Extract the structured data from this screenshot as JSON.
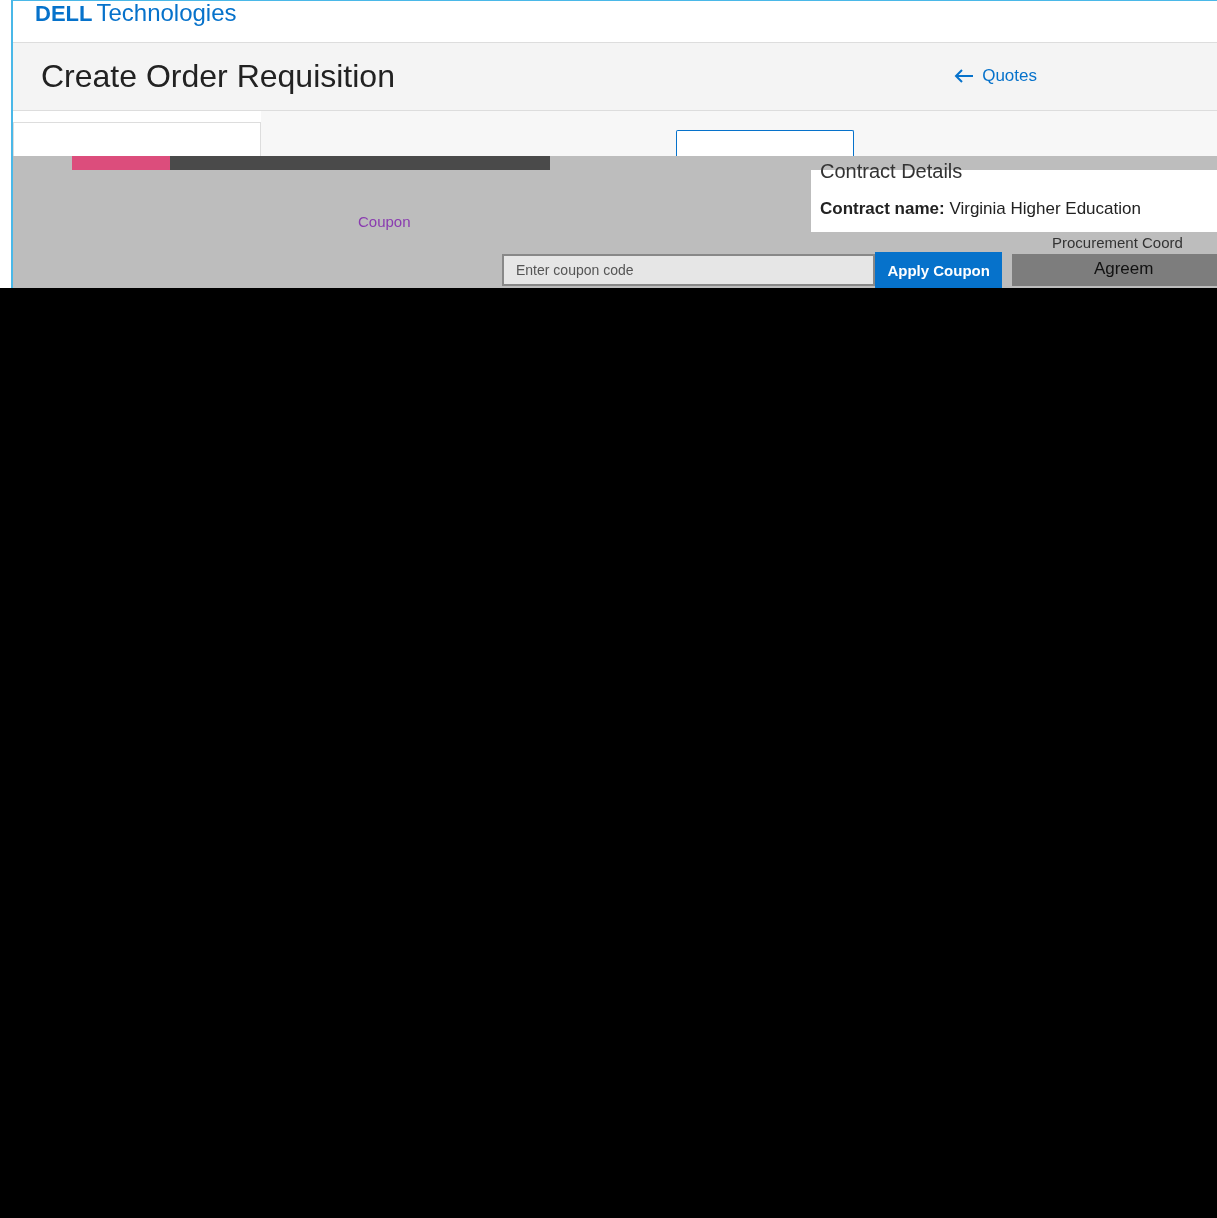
{
  "header": {
    "logo": {
      "mark": "DELL",
      "text": "Technologies"
    }
  },
  "page": {
    "title": "Create Order Requisition",
    "back_link": "Quotes"
  },
  "contract": {
    "heading": "Contract Details",
    "name_line": "**Contract name:** Virginia Higher Education",
    "procurement_label": "Procurement Coord",
    "agreement_label": "Agreem"
  },
  "coupon": {
    "label": "Coupon",
    "placeholder": "Enter coupon code",
    "button": "Apply Coupon"
  }
}
